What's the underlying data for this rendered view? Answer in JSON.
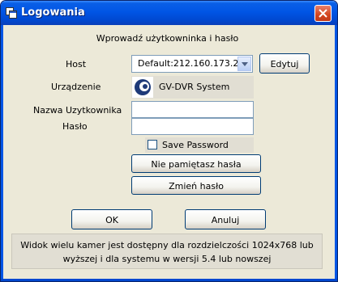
{
  "window": {
    "title": "Logowania"
  },
  "heading": "Wprowadź użytkowninka i hasło",
  "host": {
    "label": "Host",
    "value": "Default:212.160.173.2↵",
    "edit_label": "Edytuj"
  },
  "device": {
    "label": "Urządzenie",
    "name": "GV-DVR System"
  },
  "username": {
    "label": "Nazwa Uzytkownika",
    "value": ""
  },
  "password": {
    "label": "Hasło",
    "value": ""
  },
  "save_password": {
    "label": "Save Password",
    "checked": false
  },
  "buttons": {
    "forgot": "Nie pamiętasz hasła",
    "change": "Zmień hasło",
    "ok": "OK",
    "cancel": "Anuluj"
  },
  "info": {
    "line1": "Widok wielu kamer jest dostępny dla rozdzielczości 1024x768 lub",
    "line2": "wyższej i dla systemu w wersji 5.4 lub nowszej"
  },
  "colors": {
    "titlebar": "#0055E5",
    "dialog_bg": "#ECE9D8",
    "panel_bg": "#E1DED3"
  }
}
